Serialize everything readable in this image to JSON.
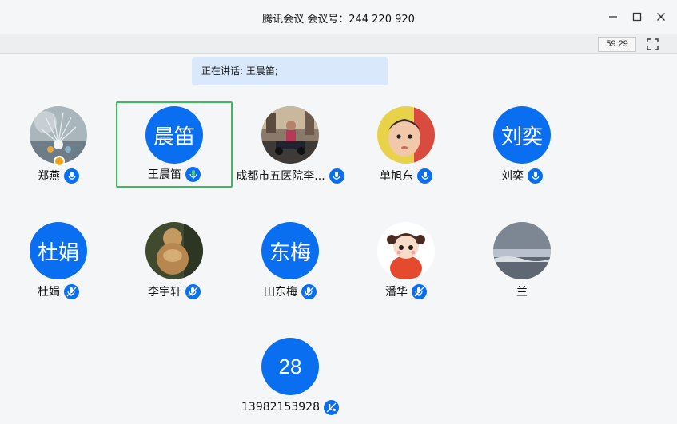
{
  "window": {
    "title": "腾讯会议 会议号：244 220 920"
  },
  "toolbar": {
    "timer": "59:29"
  },
  "speaking": {
    "text": "正在讲话: 王晨笛;"
  },
  "participants": [
    {
      "name": "郑燕",
      "avatar_type": "photo-flower",
      "muted": false,
      "host": true
    },
    {
      "name": "王晨笛",
      "avatar_type": "text",
      "avatar_text": "晨笛",
      "speaking": true,
      "active": true
    },
    {
      "name": "成都市五医院李...",
      "avatar_type": "photo-street",
      "muted": false
    },
    {
      "name": "单旭东",
      "avatar_type": "photo-child",
      "muted": false
    },
    {
      "name": "刘奕",
      "avatar_type": "text",
      "avatar_text": "刘奕",
      "muted": false
    },
    {
      "name": "杜娟",
      "avatar_type": "text",
      "avatar_text": "杜娟",
      "muted": true
    },
    {
      "name": "李宇轩",
      "avatar_type": "photo-statue",
      "muted": true
    },
    {
      "name": "田东梅",
      "avatar_type": "text",
      "avatar_text": "东梅",
      "muted": true
    },
    {
      "name": "潘华",
      "avatar_type": "photo-doll",
      "muted": true
    },
    {
      "name": "兰",
      "avatar_type": "photo-sea",
      "muted": null
    },
    {
      "name": "13982153928",
      "avatar_type": "text",
      "avatar_text": "28",
      "muted": true,
      "phone": true
    }
  ],
  "colors": {
    "accent": "#0a6ef0",
    "active_border": "#37bd5a",
    "speaking_bg": "#d9e8fb",
    "host_badge": "#f1a21b"
  },
  "icons": [
    "minimize-icon",
    "maximize-icon",
    "close-icon",
    "fullscreen-icon",
    "microphone-icon",
    "microphone-muted-icon",
    "phone-icon"
  ]
}
